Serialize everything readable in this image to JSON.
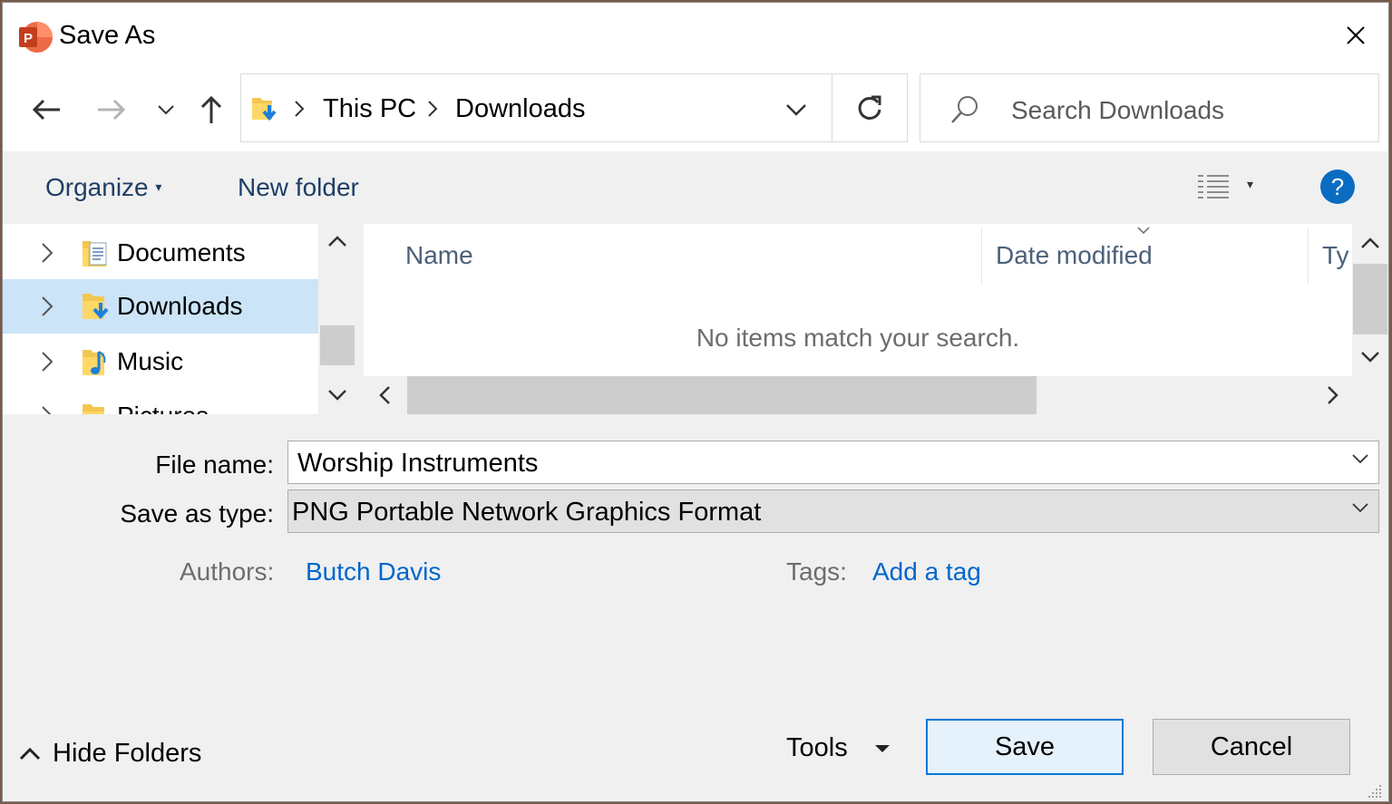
{
  "window": {
    "title": "Save As"
  },
  "breadcrumb": {
    "items": [
      "This PC",
      "Downloads"
    ]
  },
  "search": {
    "placeholder": "Search Downloads"
  },
  "toolbar": {
    "organize": "Organize",
    "new_folder": "New folder",
    "help": "?"
  },
  "tree": {
    "items": [
      {
        "label": "Documents"
      },
      {
        "label": "Downloads",
        "selected": true
      },
      {
        "label": "Music"
      },
      {
        "label": "Pictures"
      }
    ]
  },
  "filelist": {
    "columns": [
      "Name",
      "Date modified",
      "Ty"
    ],
    "empty_message": "No items match your search."
  },
  "form": {
    "file_name_label": "File name:",
    "file_name_value": "Worship Instruments",
    "save_type_label": "Save as type:",
    "save_type_value": "PNG Portable Network Graphics Format",
    "authors_label": "Authors:",
    "authors_value": "Butch Davis",
    "tags_label": "Tags:",
    "tags_value": "Add a tag"
  },
  "footer": {
    "hide_folders": "Hide Folders",
    "tools": "Tools",
    "save": "Save",
    "cancel": "Cancel"
  },
  "colors": {
    "accent": "#0066cc",
    "selection": "#cce4f7",
    "help": "#0a6cc1",
    "save_btn_bg": "#e5f1fb",
    "save_btn_border": "#0078d7",
    "app_icon": "#d04423"
  }
}
